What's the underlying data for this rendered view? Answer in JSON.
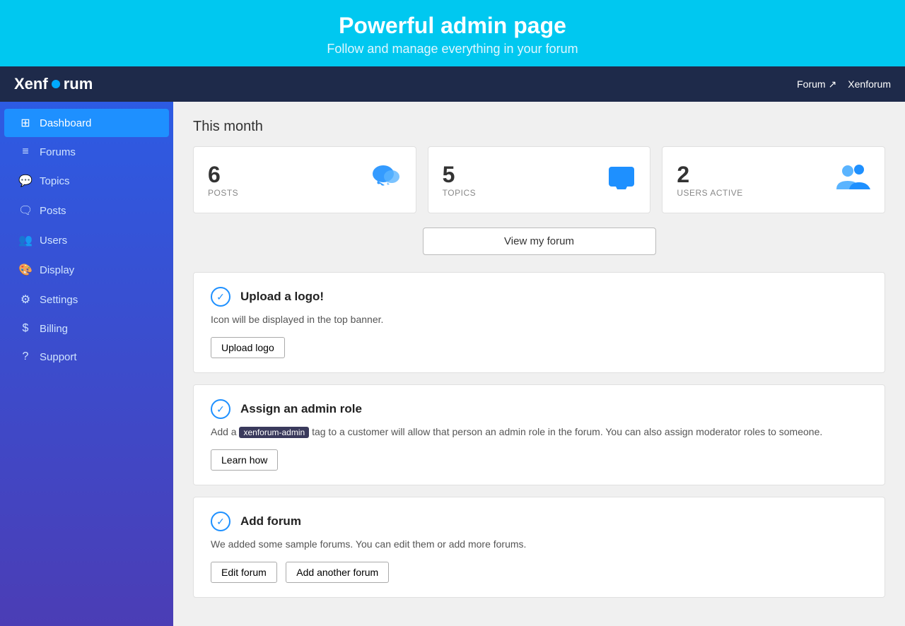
{
  "top_banner": {
    "title": "Powerful admin page",
    "subtitle": "Follow and manage everything in your forum"
  },
  "header": {
    "logo": "Xenforum",
    "forum_link": "Forum",
    "xenforum_label": "Xenforum",
    "external_icon": "↗"
  },
  "sidebar": {
    "items": [
      {
        "id": "dashboard",
        "label": "Dashboard",
        "icon": "⊞",
        "active": true
      },
      {
        "id": "forums",
        "label": "Forums",
        "icon": "☰"
      },
      {
        "id": "topics",
        "label": "Topics",
        "icon": "💬"
      },
      {
        "id": "posts",
        "label": "Posts",
        "icon": "🗨"
      },
      {
        "id": "users",
        "label": "Users",
        "icon": "👥"
      },
      {
        "id": "display",
        "label": "Display",
        "icon": "🎨"
      },
      {
        "id": "settings",
        "label": "Settings",
        "icon": "⚙"
      },
      {
        "id": "billing",
        "label": "Billing",
        "icon": "$"
      },
      {
        "id": "support",
        "label": "Support",
        "icon": "?"
      }
    ]
  },
  "main": {
    "section_title": "This month",
    "stats": [
      {
        "number": "6",
        "label": "POSTS",
        "icon": "💬"
      },
      {
        "number": "5",
        "label": "TOPICS",
        "icon": "🗨"
      },
      {
        "number": "2",
        "label": "USERS ACTIVE",
        "icon": "👥"
      }
    ],
    "view_forum_btn": "View my forum",
    "tasks": [
      {
        "id": "upload-logo",
        "title": "Upload a logo!",
        "desc": "Icon will be displayed in the top banner.",
        "btn_label": "Upload logo",
        "btn2_label": null,
        "tag": null
      },
      {
        "id": "assign-admin",
        "title": "Assign an admin role",
        "desc_before": "Add a ",
        "tag": "xenforum-admin",
        "desc_after": " tag to a customer will allow that person an admin role in the forum. You can also assign moderator roles to someone.",
        "btn_label": "Learn how",
        "btn2_label": null
      },
      {
        "id": "add-forum",
        "title": "Add forum",
        "desc": "We added some sample forums. You can edit them or add more forums.",
        "btn_label": "Edit forum",
        "btn2_label": "Add another forum",
        "tag": null
      }
    ]
  }
}
